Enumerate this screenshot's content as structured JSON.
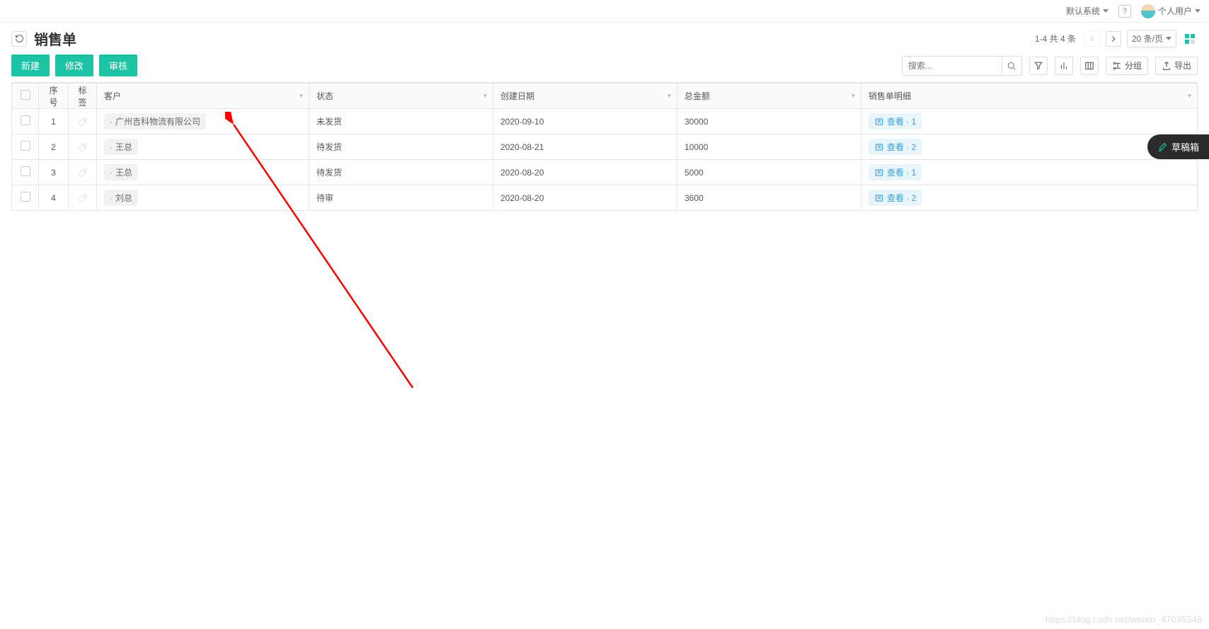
{
  "topbar": {
    "system": "默认系统",
    "help": "?",
    "user": "个人用户"
  },
  "header": {
    "title": "销售单",
    "pager_text": "1-4 共 4 条",
    "page_size": "20 条/页"
  },
  "toolbar": {
    "new": "新建",
    "edit": "修改",
    "audit": "审核",
    "search_placeholder": "搜索...",
    "group": "分组",
    "export": "导出"
  },
  "columns": {
    "seq": "序号",
    "tag": "标签",
    "customer": "客户",
    "status": "状态",
    "date": "创建日期",
    "amount": "总金额",
    "detail": "销售单明细"
  },
  "rows": [
    {
      "seq": "1",
      "customer": "广州吉科物流有限公司",
      "status": "未发货",
      "date": "2020-09-10",
      "amount": "30000",
      "view": "查看",
      "count": "1"
    },
    {
      "seq": "2",
      "customer": "王总",
      "status": "待发货",
      "date": "2020-08-21",
      "amount": "10000",
      "view": "查看",
      "count": "2"
    },
    {
      "seq": "3",
      "customer": "王总",
      "status": "待发货",
      "date": "2020-08-20",
      "amount": "5000",
      "view": "查看",
      "count": "1"
    },
    {
      "seq": "4",
      "customer": "刘总",
      "status": "待审",
      "date": "2020-08-20",
      "amount": "3600",
      "view": "查看",
      "count": "2"
    }
  ],
  "floating": {
    "draft": "草稿箱"
  },
  "watermark": "https://blog.csdn.net/weixin_47095348"
}
